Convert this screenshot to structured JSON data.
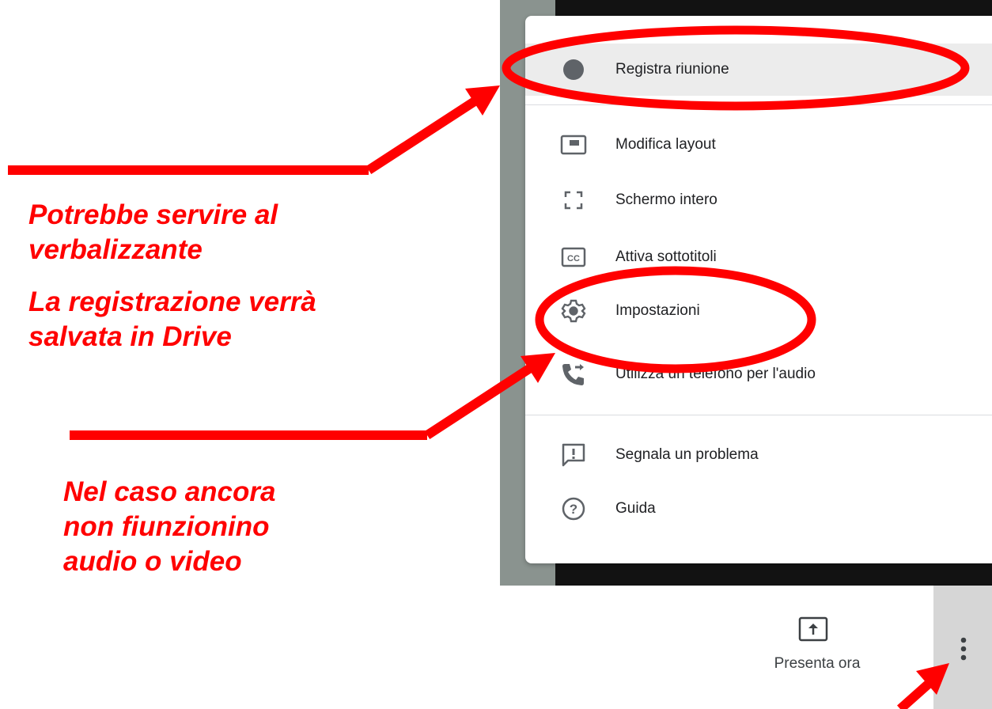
{
  "menu": {
    "items": [
      {
        "label": "Registra riunione",
        "icon": "record-dot-icon"
      },
      {
        "label": "Modifica layout",
        "icon": "layout-icon"
      },
      {
        "label": "Schermo intero",
        "icon": "fullscreen-icon"
      },
      {
        "label": "Attiva sottotitoli",
        "icon": "closed-captions-icon"
      },
      {
        "label": "Impostazioni",
        "icon": "gear-icon"
      },
      {
        "label": "Utilizza un telefono per l'audio",
        "icon": "phone-forward-icon"
      },
      {
        "label": "Segnala un problema",
        "icon": "feedback-icon"
      },
      {
        "label": "Guida",
        "icon": "help-icon"
      }
    ]
  },
  "bottom_bar": {
    "present_label": "Presenta ora",
    "present_icon": "present-screen-icon",
    "more_icon": "more-vert-icon"
  },
  "annotations": {
    "note1_line1": "Potrebbe servire al",
    "note1_line2": "verbalizzante",
    "note2_line1": "La registrazione verrà",
    "note2_line2": "salvata in Drive",
    "note3_line1": "Nel caso ancora",
    "note3_line2": "non fiunzionino",
    "note3_line3": "audio o video",
    "color": "#ff0000"
  },
  "colors": {
    "menu_highlight": "#ececec",
    "background_dark": "#121212",
    "icon": "#5f6368"
  }
}
